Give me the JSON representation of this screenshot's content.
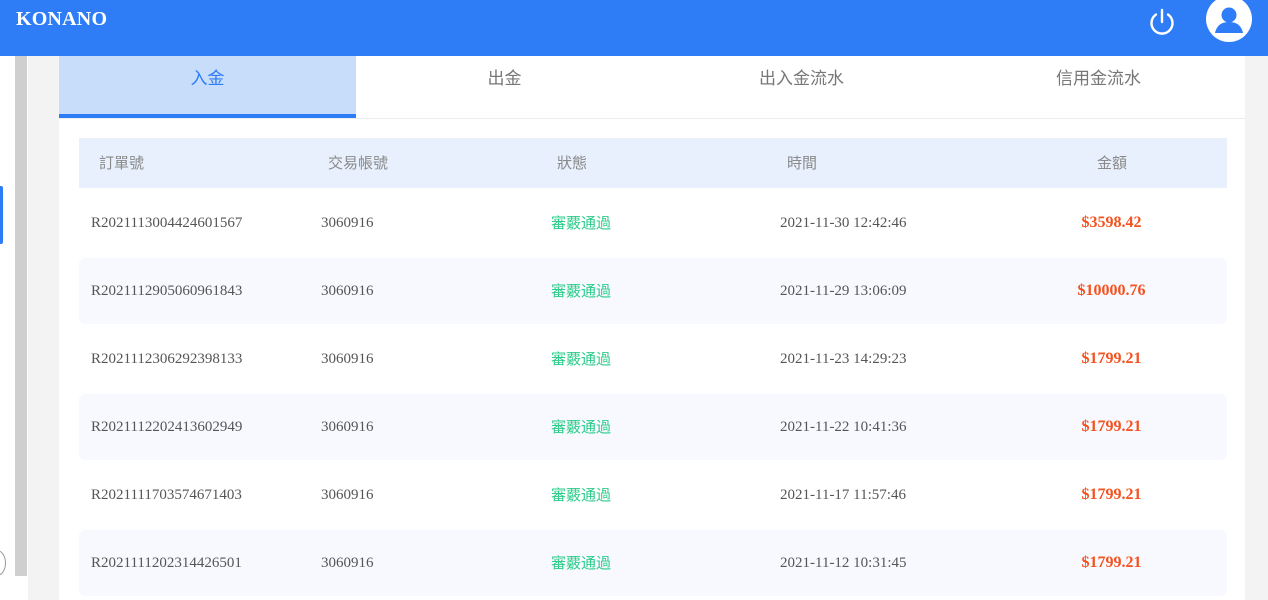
{
  "app": {
    "brand": "KONANO"
  },
  "header": {
    "power_icon": "power-icon",
    "avatar_icon": "user-avatar-icon"
  },
  "tabs": [
    {
      "label": "入金",
      "active": true
    },
    {
      "label": "出金",
      "active": false
    },
    {
      "label": "出入金流水",
      "active": false
    },
    {
      "label": "信用金流水",
      "active": false
    }
  ],
  "table": {
    "columns": [
      "訂單號",
      "交易帳號",
      "狀態",
      "時間",
      "金額"
    ],
    "rows": [
      {
        "order": "R2021113004424601567",
        "account": "3060916",
        "status": "審覈通過",
        "time": "2021-11-30 12:42:46",
        "amount": "$3598.42"
      },
      {
        "order": "R2021112905060961843",
        "account": "3060916",
        "status": "審覈通過",
        "time": "2021-11-29 13:06:09",
        "amount": "$10000.76"
      },
      {
        "order": "R2021112306292398133",
        "account": "3060916",
        "status": "審覈通過",
        "time": "2021-11-23 14:29:23",
        "amount": "$1799.21"
      },
      {
        "order": "R2021112202413602949",
        "account": "3060916",
        "status": "審覈通過",
        "time": "2021-11-22 10:41:36",
        "amount": "$1799.21"
      },
      {
        "order": "R2021111703574671403",
        "account": "3060916",
        "status": "審覈通過",
        "time": "2021-11-17 11:57:46",
        "amount": "$1799.21"
      },
      {
        "order": "R2021111202314426501",
        "account": "3060916",
        "status": "審覈通過",
        "time": "2021-11-12 10:31:45",
        "amount": "$1799.21"
      }
    ]
  },
  "colors": {
    "header_bg": "#2e7cf6",
    "status_ok": "#2ecc8a",
    "amount": "#f4511e"
  }
}
